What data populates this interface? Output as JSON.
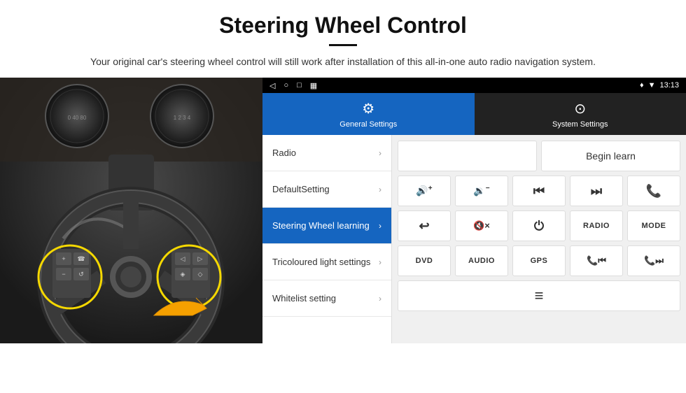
{
  "header": {
    "title": "Steering Wheel Control",
    "subtitle": "Your original car's steering wheel control will still work after installation of this all-in-one auto radio navigation system."
  },
  "status_bar": {
    "time": "13:13",
    "icons": [
      "location",
      "signal",
      "wifi"
    ]
  },
  "tabs": [
    {
      "id": "general",
      "label": "General Settings",
      "active": true
    },
    {
      "id": "system",
      "label": "System Settings",
      "active": false
    }
  ],
  "menu_items": [
    {
      "id": "radio",
      "label": "Radio",
      "active": false
    },
    {
      "id": "default",
      "label": "DefaultSetting",
      "active": false
    },
    {
      "id": "steering",
      "label": "Steering Wheel learning",
      "active": true
    },
    {
      "id": "tricoloured",
      "label": "Tricoloured light settings",
      "active": false
    },
    {
      "id": "whitelist",
      "label": "Whitelist setting",
      "active": false
    }
  ],
  "control_panel": {
    "begin_learn_label": "Begin learn",
    "buttons_row1": [
      {
        "id": "vol-up",
        "label": "🔊+",
        "type": "icon"
      },
      {
        "id": "vol-down",
        "label": "🔉−",
        "type": "icon"
      },
      {
        "id": "prev-track",
        "label": "⏮",
        "type": "icon"
      },
      {
        "id": "next-track",
        "label": "⏭",
        "type": "icon"
      },
      {
        "id": "phone",
        "label": "📞",
        "type": "icon"
      }
    ],
    "buttons_row2": [
      {
        "id": "hang-up",
        "label": "↩",
        "type": "icon"
      },
      {
        "id": "mute",
        "label": "🔇×",
        "type": "icon"
      },
      {
        "id": "power",
        "label": "⏻",
        "type": "icon"
      },
      {
        "id": "radio-btn",
        "label": "RADIO",
        "type": "text"
      },
      {
        "id": "mode",
        "label": "MODE",
        "type": "text"
      }
    ],
    "buttons_row3": [
      {
        "id": "dvd",
        "label": "DVD",
        "type": "text"
      },
      {
        "id": "audio",
        "label": "AUDIO",
        "type": "text"
      },
      {
        "id": "gps",
        "label": "GPS",
        "type": "text"
      },
      {
        "id": "tel-prev",
        "label": "📞⏮",
        "type": "icon"
      },
      {
        "id": "tel-next",
        "label": "📞⏭",
        "type": "icon"
      }
    ],
    "buttons_row4": [
      {
        "id": "list-icon",
        "label": "≡",
        "type": "icon"
      }
    ]
  }
}
